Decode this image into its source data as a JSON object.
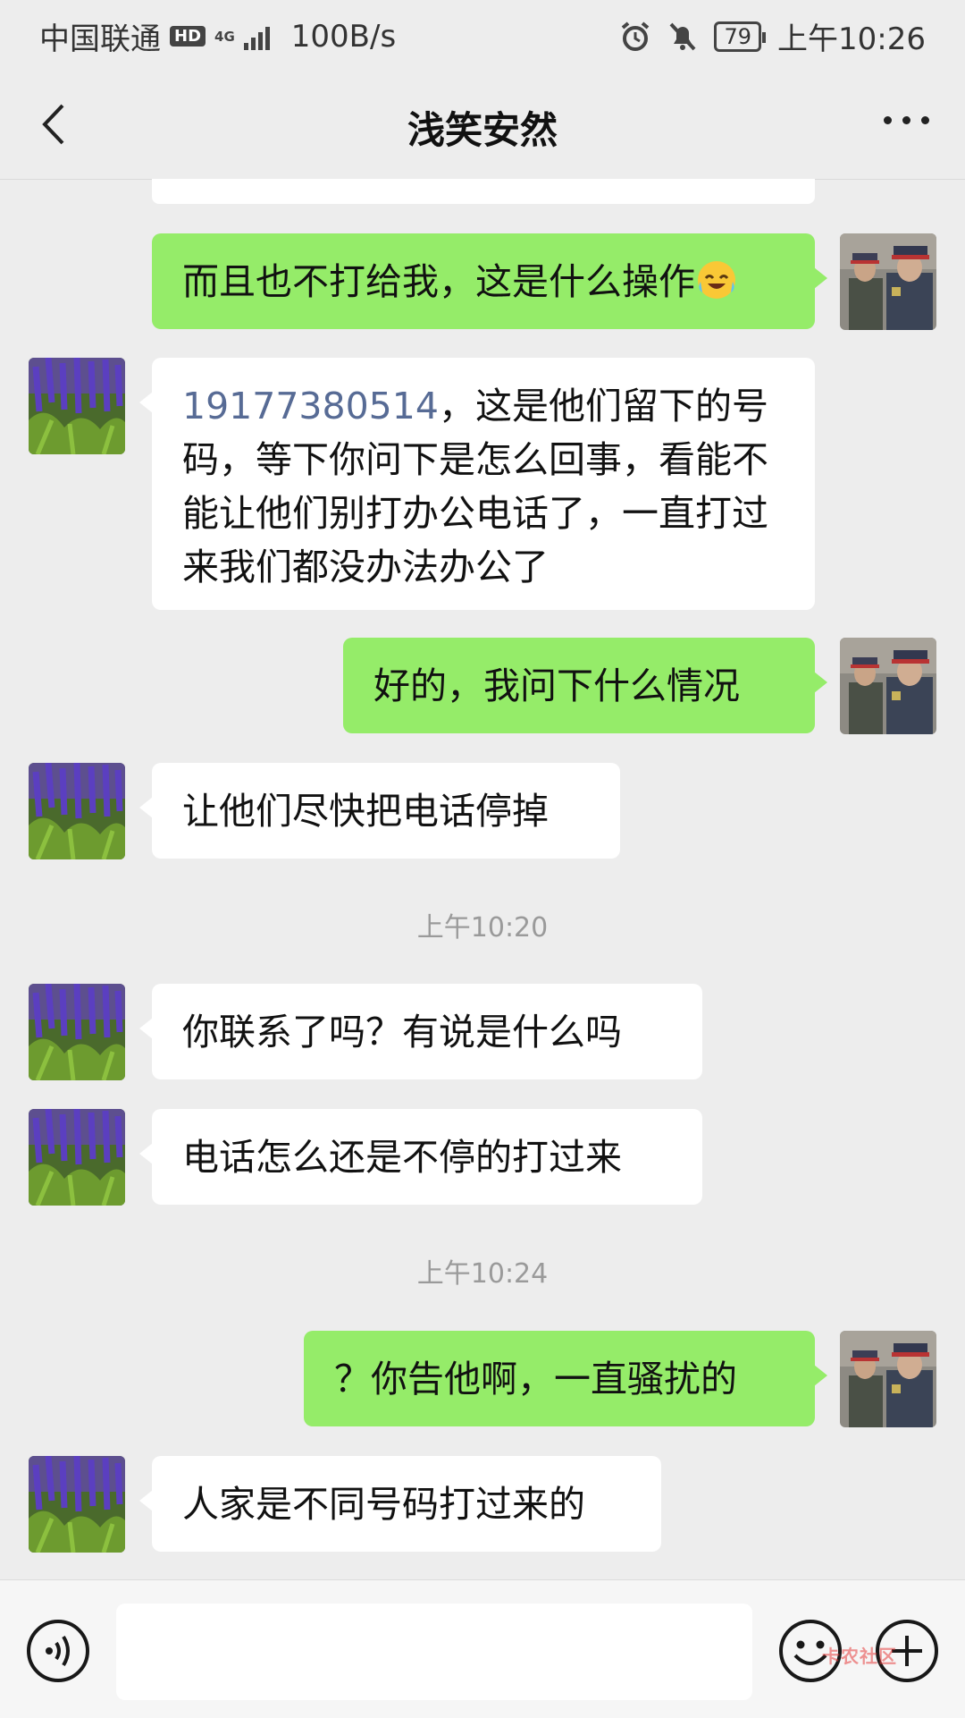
{
  "status_bar": {
    "carrier": "中国联通",
    "hd": "HD",
    "network": "4G",
    "speed": "100B/s",
    "battery": "79",
    "time": "上午10:26",
    "icons": [
      "alarm-icon",
      "mute-bell-icon",
      "battery-icon",
      "signal-icon"
    ]
  },
  "header": {
    "title": "浅笑安然",
    "back_icon": "chevron-left-icon",
    "more_icon": "more-dots-icon"
  },
  "messages": [
    {
      "side": "right",
      "text": "而且也不打给我，这是什么操作",
      "emoji": "laughing-crying-emoji"
    },
    {
      "side": "left",
      "phone": "19177380514",
      "text": "，这是他们留下的号码，等下你问下是怎么回事，看能不能让他们别打办公电话了，一直打过来我们都没办法办公了"
    },
    {
      "side": "right",
      "text": "好的，我问下什么情况"
    },
    {
      "side": "left",
      "text": "让他们尽快把电话停掉"
    },
    {
      "type": "time",
      "text": "上午10:20"
    },
    {
      "side": "left",
      "text": "你联系了吗？有说是什么吗"
    },
    {
      "side": "left",
      "text": "电话怎么还是不停的打过来"
    },
    {
      "type": "time",
      "text": "上午10:24"
    },
    {
      "side": "right",
      "text": "？你告他啊，一直骚扰的"
    },
    {
      "side": "left",
      "text": "人家是不同号码打过来的"
    }
  ],
  "input_bar": {
    "placeholder": "",
    "icons": [
      "voice-icon",
      "emoji-icon",
      "plus-icon"
    ]
  },
  "watermark": "卡农社区",
  "colors": {
    "background": "#ededed",
    "own_bubble": "#95ec69",
    "other_bubble": "#ffffff",
    "link": "#576b95"
  }
}
